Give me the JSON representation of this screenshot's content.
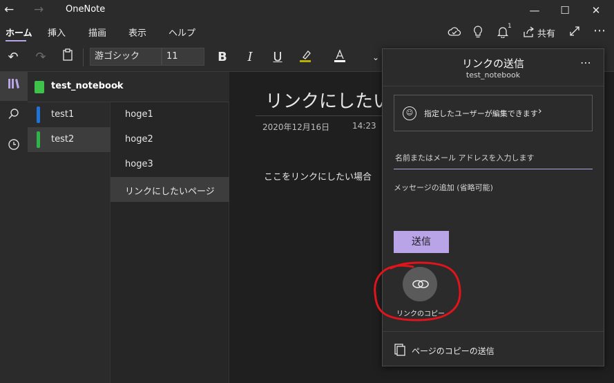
{
  "app": {
    "title": "OneNote"
  },
  "ribbon": {
    "tabs": [
      {
        "label": "ホーム",
        "active": true
      },
      {
        "label": "挿入"
      },
      {
        "label": "描画"
      },
      {
        "label": "表示"
      },
      {
        "label": "ヘルプ"
      }
    ],
    "share_label": "共有",
    "notification_count": "1"
  },
  "toolbar": {
    "font_name": "游ゴシック",
    "font_size": "11"
  },
  "notebook": {
    "name": "test_notebook"
  },
  "sections": [
    {
      "label": "test1",
      "color": "#1e72d8"
    },
    {
      "label": "test2",
      "color": "#2fb44a",
      "selected": true
    }
  ],
  "pages": [
    {
      "label": "hoge1"
    },
    {
      "label": "hoge2"
    },
    {
      "label": "hoge3"
    },
    {
      "label": "リンクにしたいページ",
      "selected": true
    }
  ],
  "canvas": {
    "title": "リンクにしたい",
    "date": "2020年12月16日",
    "time": "14:23",
    "body": "ここをリンクにしたい場合"
  },
  "share_panel": {
    "title": "リンクの送信",
    "subtitle": "test_notebook",
    "permission_label": "指定したユーザーが編集できます",
    "email_placeholder": "名前またはメール アドレスを入力します",
    "message_placeholder": "メッセージの追加 (省略可能)",
    "send_label": "送信",
    "copy_link_label": "リンクのコピー",
    "send_copy_label": "ページのコピーの送信"
  },
  "colors": {
    "accent": "#b9a4e8",
    "annotation": "#e0141c"
  }
}
